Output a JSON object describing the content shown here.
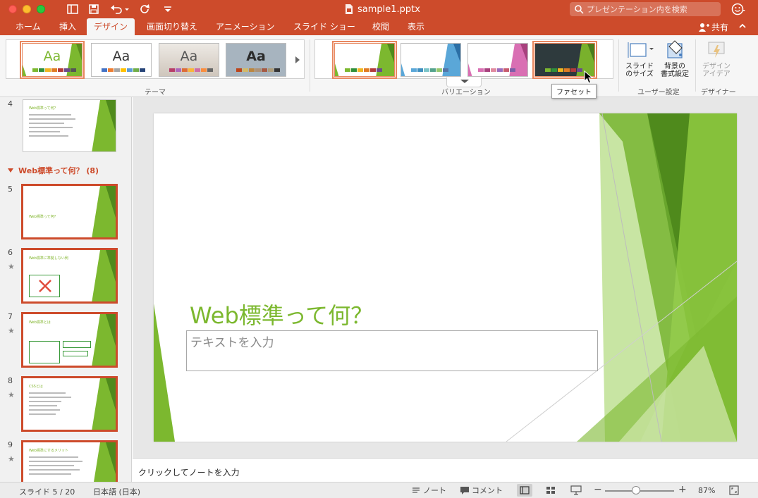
{
  "window": {
    "title": "sample1.pptx",
    "search_placeholder": "プレゼンテーション内を検索"
  },
  "tabs": [
    {
      "label": "ホーム"
    },
    {
      "label": "挿入"
    },
    {
      "label": "デザイン",
      "active": true
    },
    {
      "label": "画面切り替え"
    },
    {
      "label": "アニメーション"
    },
    {
      "label": "スライド ショー"
    },
    {
      "label": "校閲"
    },
    {
      "label": "表示"
    }
  ],
  "share_label": "共有",
  "ribbon": {
    "themes_group_label": "テーマ",
    "variants_group_label": "バリエーション",
    "customize_group_label": "ユーザー設定",
    "designer_group_label": "デザイナー",
    "themes": [
      {
        "text": "Aa",
        "selected": true
      },
      {
        "text": "Aa"
      },
      {
        "text": "Aa"
      },
      {
        "text": "Aa"
      }
    ],
    "slide_size_label_1": "スライド",
    "slide_size_label_2": "のサイズ",
    "bg_format_label_1": "背景の",
    "bg_format_label_2": "書式設定",
    "design_ideas_label_1": "デザイン",
    "design_ideas_label_2": "アイデア",
    "tooltip": "ファセット"
  },
  "slide_panel": {
    "section_title": "Web標準って何？ (8)",
    "slides": [
      {
        "number": "4",
        "title": "Web標準って何？"
      },
      {
        "number": "5",
        "title": "Web標準って何？"
      },
      {
        "number": "6",
        "title": "Web標準に準拠しない例"
      },
      {
        "number": "7",
        "title": "Web標準とは"
      },
      {
        "number": "8",
        "title": "CSSとは"
      },
      {
        "number": "9",
        "title": "Web標準にするメリット"
      }
    ]
  },
  "slide": {
    "title": "Web標準って何？",
    "body_placeholder": "テキストを入力"
  },
  "notes_placeholder": "クリックしてノートを入力",
  "status": {
    "slide_indicator": "スライド 5 / 20",
    "language": "日本語 (日本)",
    "notes_label": "ノート",
    "comments_label": "コメント",
    "zoom": "87%"
  },
  "colors": {
    "accent": "#cd4b2b",
    "theme_green": "#7cb82f"
  }
}
